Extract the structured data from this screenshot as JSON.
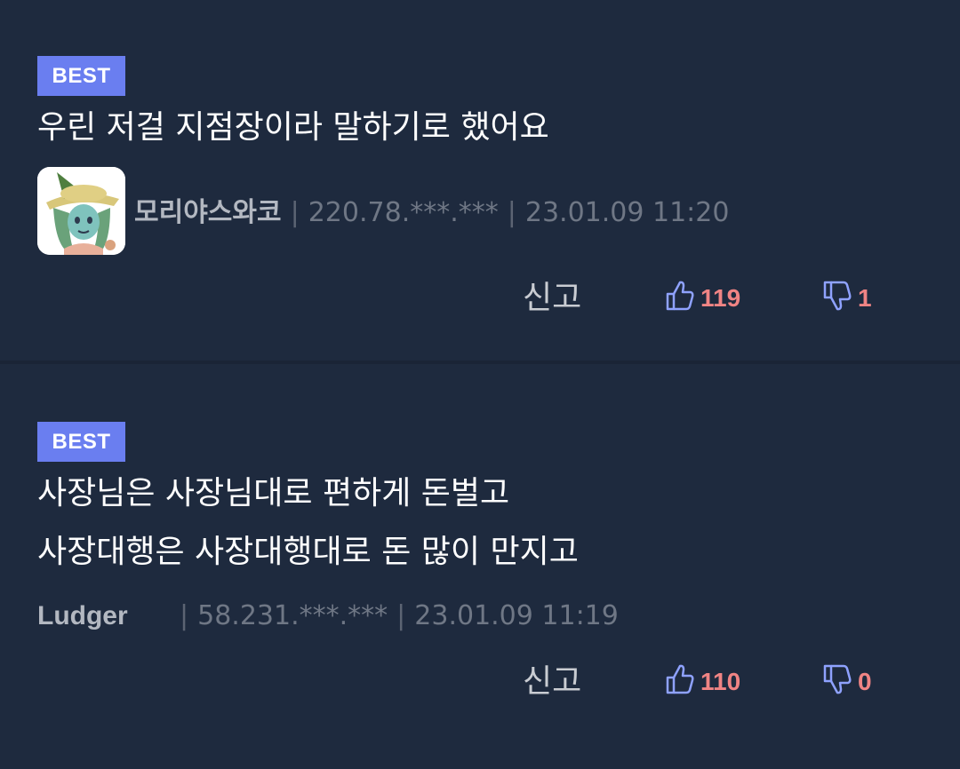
{
  "comments": [
    {
      "badge": "BEST",
      "lines": [
        "우린 저걸 지점장이라 말하기로 했어요"
      ],
      "author": "모리야스와코",
      "separator": "|",
      "ip": "220.78.***.***",
      "datetime": "23.01.09 11:20",
      "report_label": "신고",
      "upvotes": "119",
      "downvotes": "1",
      "has_avatar": true
    },
    {
      "badge": "BEST",
      "lines": [
        "사장님은 사장님대로 편하게 돈벌고",
        "사장대행은 사장대행대로 돈 많이 만지고"
      ],
      "author": "Ludger",
      "separator": "|",
      "ip": "58.231.***.***",
      "datetime": "23.01.09 11:19",
      "report_label": "신고",
      "upvotes": "110",
      "downvotes": "0",
      "has_avatar": false
    }
  ],
  "colors": {
    "background": "#1e2a3e",
    "badge": "#6a7ef0",
    "vote_count": "#f08484",
    "thumb_icon": "#8fa2ff"
  },
  "icons": [
    "thumbs-up-icon",
    "thumbs-down-icon"
  ]
}
